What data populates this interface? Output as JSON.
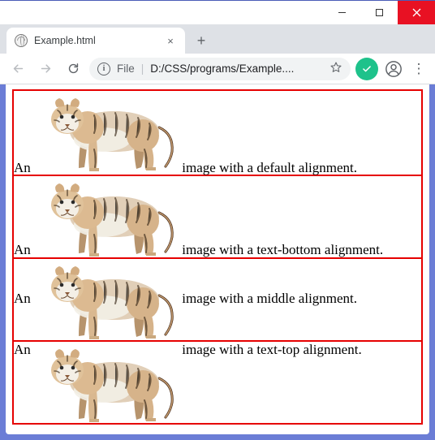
{
  "window": {
    "minimize_tip": "Minimize",
    "maximize_tip": "Maximize",
    "close_tip": "Close"
  },
  "tab": {
    "title": "Example.html",
    "close_tip": "Close tab",
    "newtab_tip": "New tab"
  },
  "toolbar": {
    "back_tip": "Back",
    "forward_tip": "Forward",
    "reload_tip": "Reload",
    "info_label": "File",
    "url": "D:/CSS/programs/Example....",
    "star_tip": "Bookmark",
    "extension_tip": "Extension",
    "profile_tip": "Profile",
    "menu_tip": "Menu"
  },
  "content": {
    "rows": [
      {
        "prefix": "An",
        "suffix": "image with a default alignment.",
        "valign": "baseline"
      },
      {
        "prefix": "An",
        "suffix": "image with a text-bottom alignment.",
        "valign": "text-bottom"
      },
      {
        "prefix": "An",
        "suffix": "image with a middle alignment.",
        "valign": "middle"
      },
      {
        "prefix": "An",
        "suffix": "image with a text-top alignment.",
        "valign": "text-top"
      }
    ],
    "image_alt": "tiger"
  }
}
